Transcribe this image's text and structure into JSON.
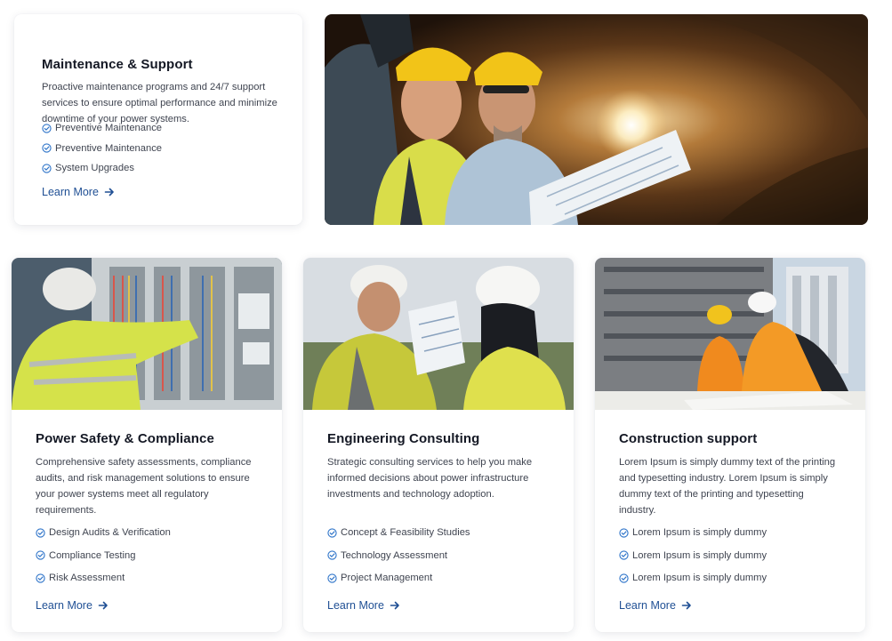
{
  "colors": {
    "accent": "#1f4f94",
    "check": "#2e74c9",
    "heading": "#141824",
    "body_text": "#3f4450"
  },
  "maintenance": {
    "title": "Maintenance & Support",
    "description": "Proactive maintenance programs and 24/7 support services to ensure optimal performance and minimize downtime of your power systems.",
    "features": [
      "Preventive Maintenance",
      "Preventive Maintenance",
      "System Upgrades"
    ],
    "link_label": "Learn More"
  },
  "hero": {
    "image_icon": "workers-in-tunnel-photo"
  },
  "services": [
    {
      "title": "Power Safety & Compliance",
      "description": "Comprehensive safety assessments, compliance audits, and risk management solutions to ensure your power systems meet all regulatory requirements.",
      "features": [
        "Design Audits & Verification",
        "Compliance Testing",
        "Risk Assessment"
      ],
      "link_label": "Learn More",
      "image_icon": "electrician-at-panel-photo"
    },
    {
      "title": "Engineering Consulting",
      "description": "Strategic consulting services to help you make informed decisions about power infrastructure investments and technology adoption.",
      "features": [
        "Concept & Feasibility Studies",
        "Technology Assessment",
        "Project Management"
      ],
      "link_label": "Learn More",
      "image_icon": "engineers-reviewing-plans-photo"
    },
    {
      "title": "Construction support",
      "description": "Lorem Ipsum is simply dummy text of the printing and typesetting industry. Lorem Ipsum is simply dummy text of the printing and typesetting industry.",
      "features": [
        "Lorem Ipsum is simply dummy",
        "Lorem Ipsum is simply dummy",
        "Lorem Ipsum is simply dummy"
      ],
      "link_label": "Learn More",
      "image_icon": "construction-site-photo"
    }
  ]
}
